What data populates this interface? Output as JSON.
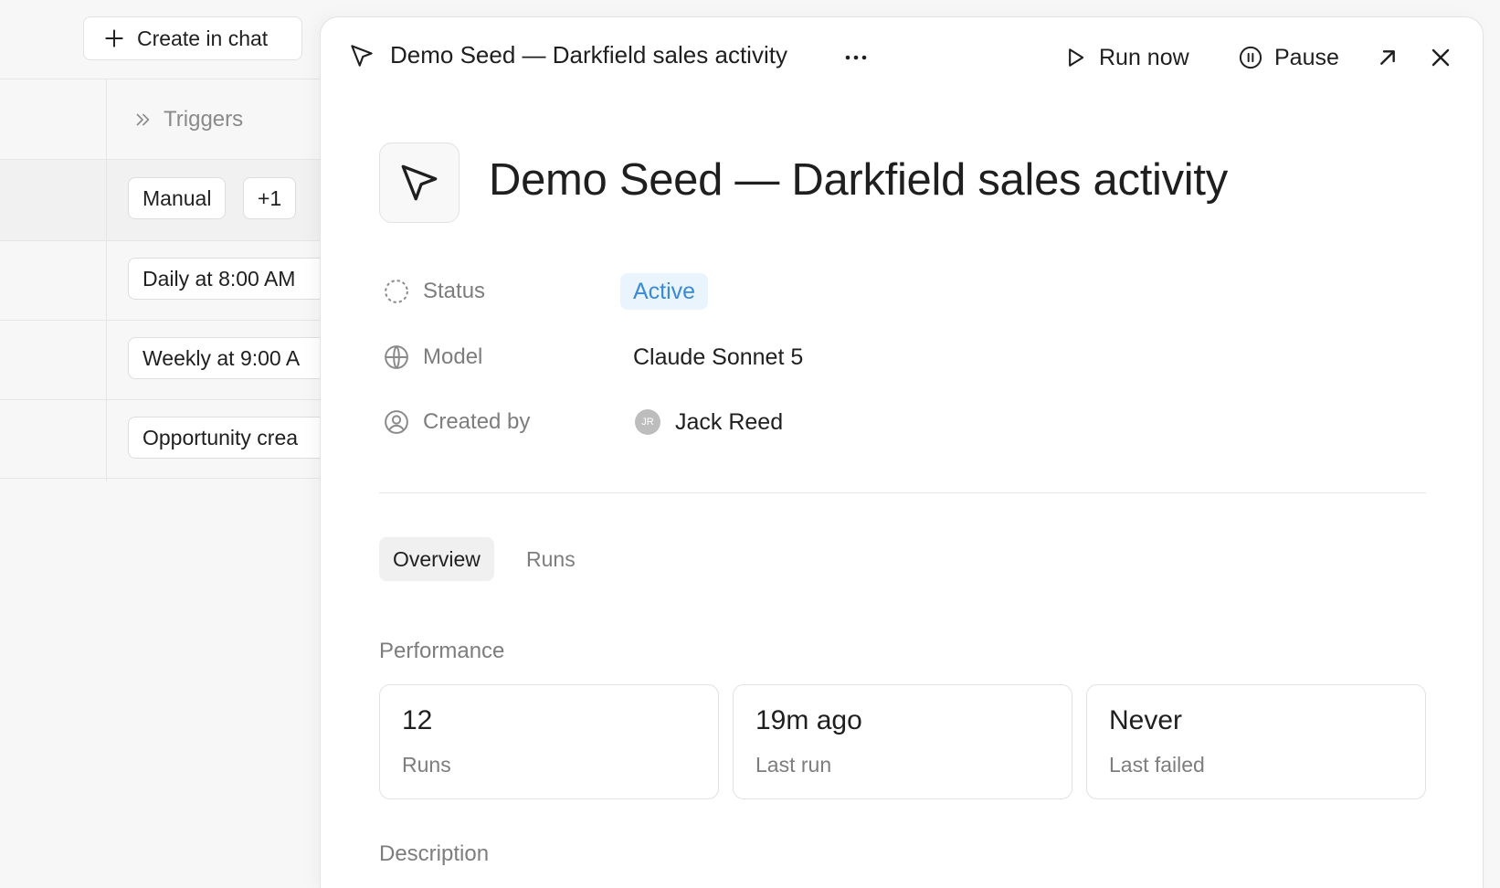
{
  "background": {
    "create_button_label": "Create in chat",
    "column_header": "Triggers",
    "rows": [
      {
        "triggers": [
          "Manual",
          "+1"
        ]
      },
      {
        "triggers": [
          "Daily at 8:00 AM"
        ]
      },
      {
        "triggers": [
          "Weekly at 9:00 A"
        ]
      },
      {
        "triggers": [
          "Opportunity crea"
        ]
      }
    ]
  },
  "drawer": {
    "title": "Demo Seed — Darkfield sales activity",
    "actions": {
      "run_now": "Run now",
      "pause": "Pause"
    },
    "heading": "Demo Seed — Darkfield sales activity",
    "properties": {
      "status_label": "Status",
      "status_value": "Active",
      "model_label": "Model",
      "model_value": "Claude Sonnet 5",
      "created_by_label": "Created by",
      "created_by_initials": "JR",
      "created_by_value": "Jack Reed"
    },
    "tabs": [
      {
        "label": "Overview",
        "active": true
      },
      {
        "label": "Runs",
        "active": false
      }
    ],
    "performance": {
      "title": "Performance",
      "cards": [
        {
          "value": "12",
          "label": "Runs"
        },
        {
          "value": "19m ago",
          "label": "Last run"
        },
        {
          "value": "Never",
          "label": "Last failed"
        }
      ]
    },
    "description_title": "Description"
  },
  "colors": {
    "status_badge_bg": "#eaf4fd",
    "status_badge_text": "#3a8ad6"
  }
}
